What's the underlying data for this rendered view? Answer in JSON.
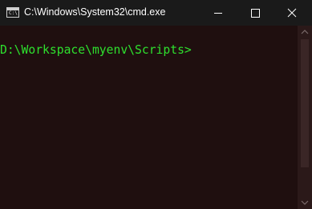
{
  "window": {
    "title": "C:\\Windows\\System32\\cmd.exe",
    "icon_text": "C:\\"
  },
  "console": {
    "prompt": "D:\\Workspace\\myenv\\Scripts>"
  },
  "colors": {
    "background": "#1f0f0f",
    "titlebar": "#1a1a1a",
    "prompt_text": "#2ee02e"
  },
  "icons": {
    "app": "cmd-app-icon",
    "minimize": "minimize-icon",
    "maximize": "maximize-icon",
    "close": "close-icon",
    "scroll_up": "chevron-up-icon",
    "scroll_down": "chevron-down-icon"
  }
}
